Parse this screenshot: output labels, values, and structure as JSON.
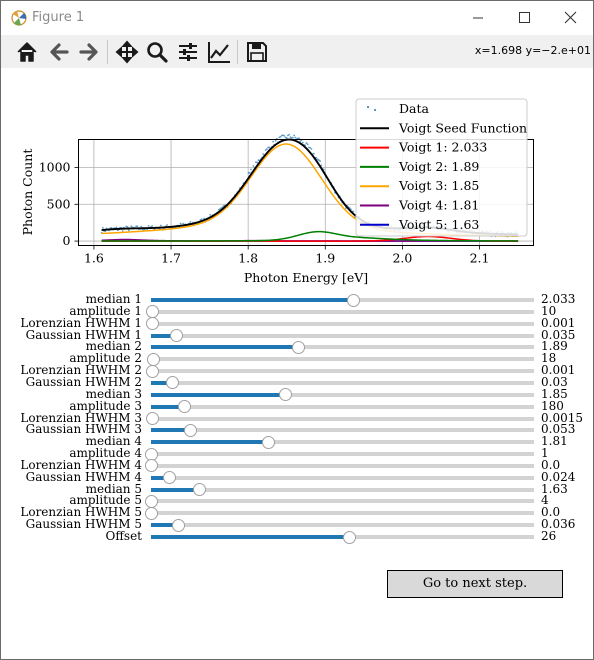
{
  "window": {
    "title": "Figure 1",
    "controls": [
      "minimize-icon",
      "maximize-icon",
      "close-icon"
    ]
  },
  "toolbar": {
    "tools": [
      "home-icon",
      "back-arrow-icon",
      "forward-arrow-icon",
      "pan-move-icon",
      "zoom-magnifier-icon",
      "subplot-config-icon",
      "edit-axes-icon",
      "save-floppy-icon"
    ],
    "coords": "x=1.698 y=−2.e+01"
  },
  "chart_data": {
    "type": "line",
    "xlabel": "Photon Energy [eV]",
    "ylabel": "Photon Count",
    "xlim": [
      1.58,
      2.17
    ],
    "ylim": [
      -60,
      1380
    ],
    "xticks": [
      "1.6",
      "1.7",
      "1.8",
      "1.9",
      "2.0",
      "2.1"
    ],
    "yticks": [
      "0",
      "500",
      "1000"
    ],
    "xtick_values": [
      1.6,
      1.7,
      1.8,
      1.9,
      2.0,
      2.1
    ],
    "ytick_values": [
      0,
      500,
      1000
    ],
    "grid": true,
    "legend_placement": "top-right",
    "x_range": [
      1.61,
      2.15
    ],
    "series": [
      {
        "name": "Data",
        "style": "scatter",
        "color": "#1f77b4"
      },
      {
        "name": "Voigt Seed Function",
        "color": "#000000"
      },
      {
        "name": "Voigt 1: 2.033",
        "color": "#ff0000"
      },
      {
        "name": "Voigt 2: 1.89",
        "color": "#008000"
      },
      {
        "name": "Voigt 3: 1.85",
        "color": "#ffa500"
      },
      {
        "name": "Voigt 4: 1.81",
        "color": "#800080"
      },
      {
        "name": "Voigt 5: 1.63",
        "color": "#0000cc"
      }
    ],
    "components": [
      {
        "center": 2.033,
        "amplitude": 10,
        "lorentzian_hwhm": 0.001,
        "gaussian_hwhm": 0.035
      },
      {
        "center": 1.89,
        "amplitude": 18,
        "lorentzian_hwhm": 0.001,
        "gaussian_hwhm": 0.03
      },
      {
        "center": 1.85,
        "amplitude": 180,
        "lorentzian_hwhm": 0.0015,
        "gaussian_hwhm": 0.053
      },
      {
        "center": 1.81,
        "amplitude": 1,
        "lorentzian_hwhm": 0.0,
        "gaussian_hwhm": 0.024
      },
      {
        "center": 1.63,
        "amplitude": 4,
        "lorentzian_hwhm": 0.0,
        "gaussian_hwhm": 0.036
      }
    ],
    "offset": 26
  },
  "sliders": [
    {
      "label": "median 1",
      "value": "2.033",
      "fraction": 0.53
    },
    {
      "label": "amplitude 1",
      "value": "10",
      "fraction": 0.004
    },
    {
      "label": "Lorenzian HWHM 1",
      "value": "0.001",
      "fraction": 0.003
    },
    {
      "label": "Gaussian HWHM 1",
      "value": "0.035",
      "fraction": 0.067
    },
    {
      "label": "median 2",
      "value": "1.89",
      "fraction": 0.385
    },
    {
      "label": "amplitude 2",
      "value": "18",
      "fraction": 0.007
    },
    {
      "label": "Lorenzian HWHM 2",
      "value": "0.001",
      "fraction": 0.003
    },
    {
      "label": "Gaussian HWHM 2",
      "value": "0.03",
      "fraction": 0.057
    },
    {
      "label": "median 3",
      "value": "1.85",
      "fraction": 0.35
    },
    {
      "label": "amplitude 3",
      "value": "180",
      "fraction": 0.088
    },
    {
      "label": "Lorenzian HWHM 3",
      "value": "0.0015",
      "fraction": 0.004
    },
    {
      "label": "Gaussian HWHM 3",
      "value": "0.053",
      "fraction": 0.104
    },
    {
      "label": "median 4",
      "value": "1.81",
      "fraction": 0.308
    },
    {
      "label": "amplitude 4",
      "value": "1",
      "fraction": 0.0
    },
    {
      "label": "Lorenzian HWHM 4",
      "value": "0.0",
      "fraction": 0.0
    },
    {
      "label": "Gaussian HWHM 4",
      "value": "0.024",
      "fraction": 0.047
    },
    {
      "label": "median 5",
      "value": "1.63",
      "fraction": 0.127
    },
    {
      "label": "amplitude 5",
      "value": "4",
      "fraction": 0.0
    },
    {
      "label": "Lorenzian HWHM 5",
      "value": "0.0",
      "fraction": 0.0
    },
    {
      "label": "Gaussian HWHM 5",
      "value": "0.036",
      "fraction": 0.072
    },
    {
      "label": "Offset",
      "value": "26",
      "fraction": 0.517
    }
  ],
  "next_button": {
    "label": "Go to next step."
  }
}
